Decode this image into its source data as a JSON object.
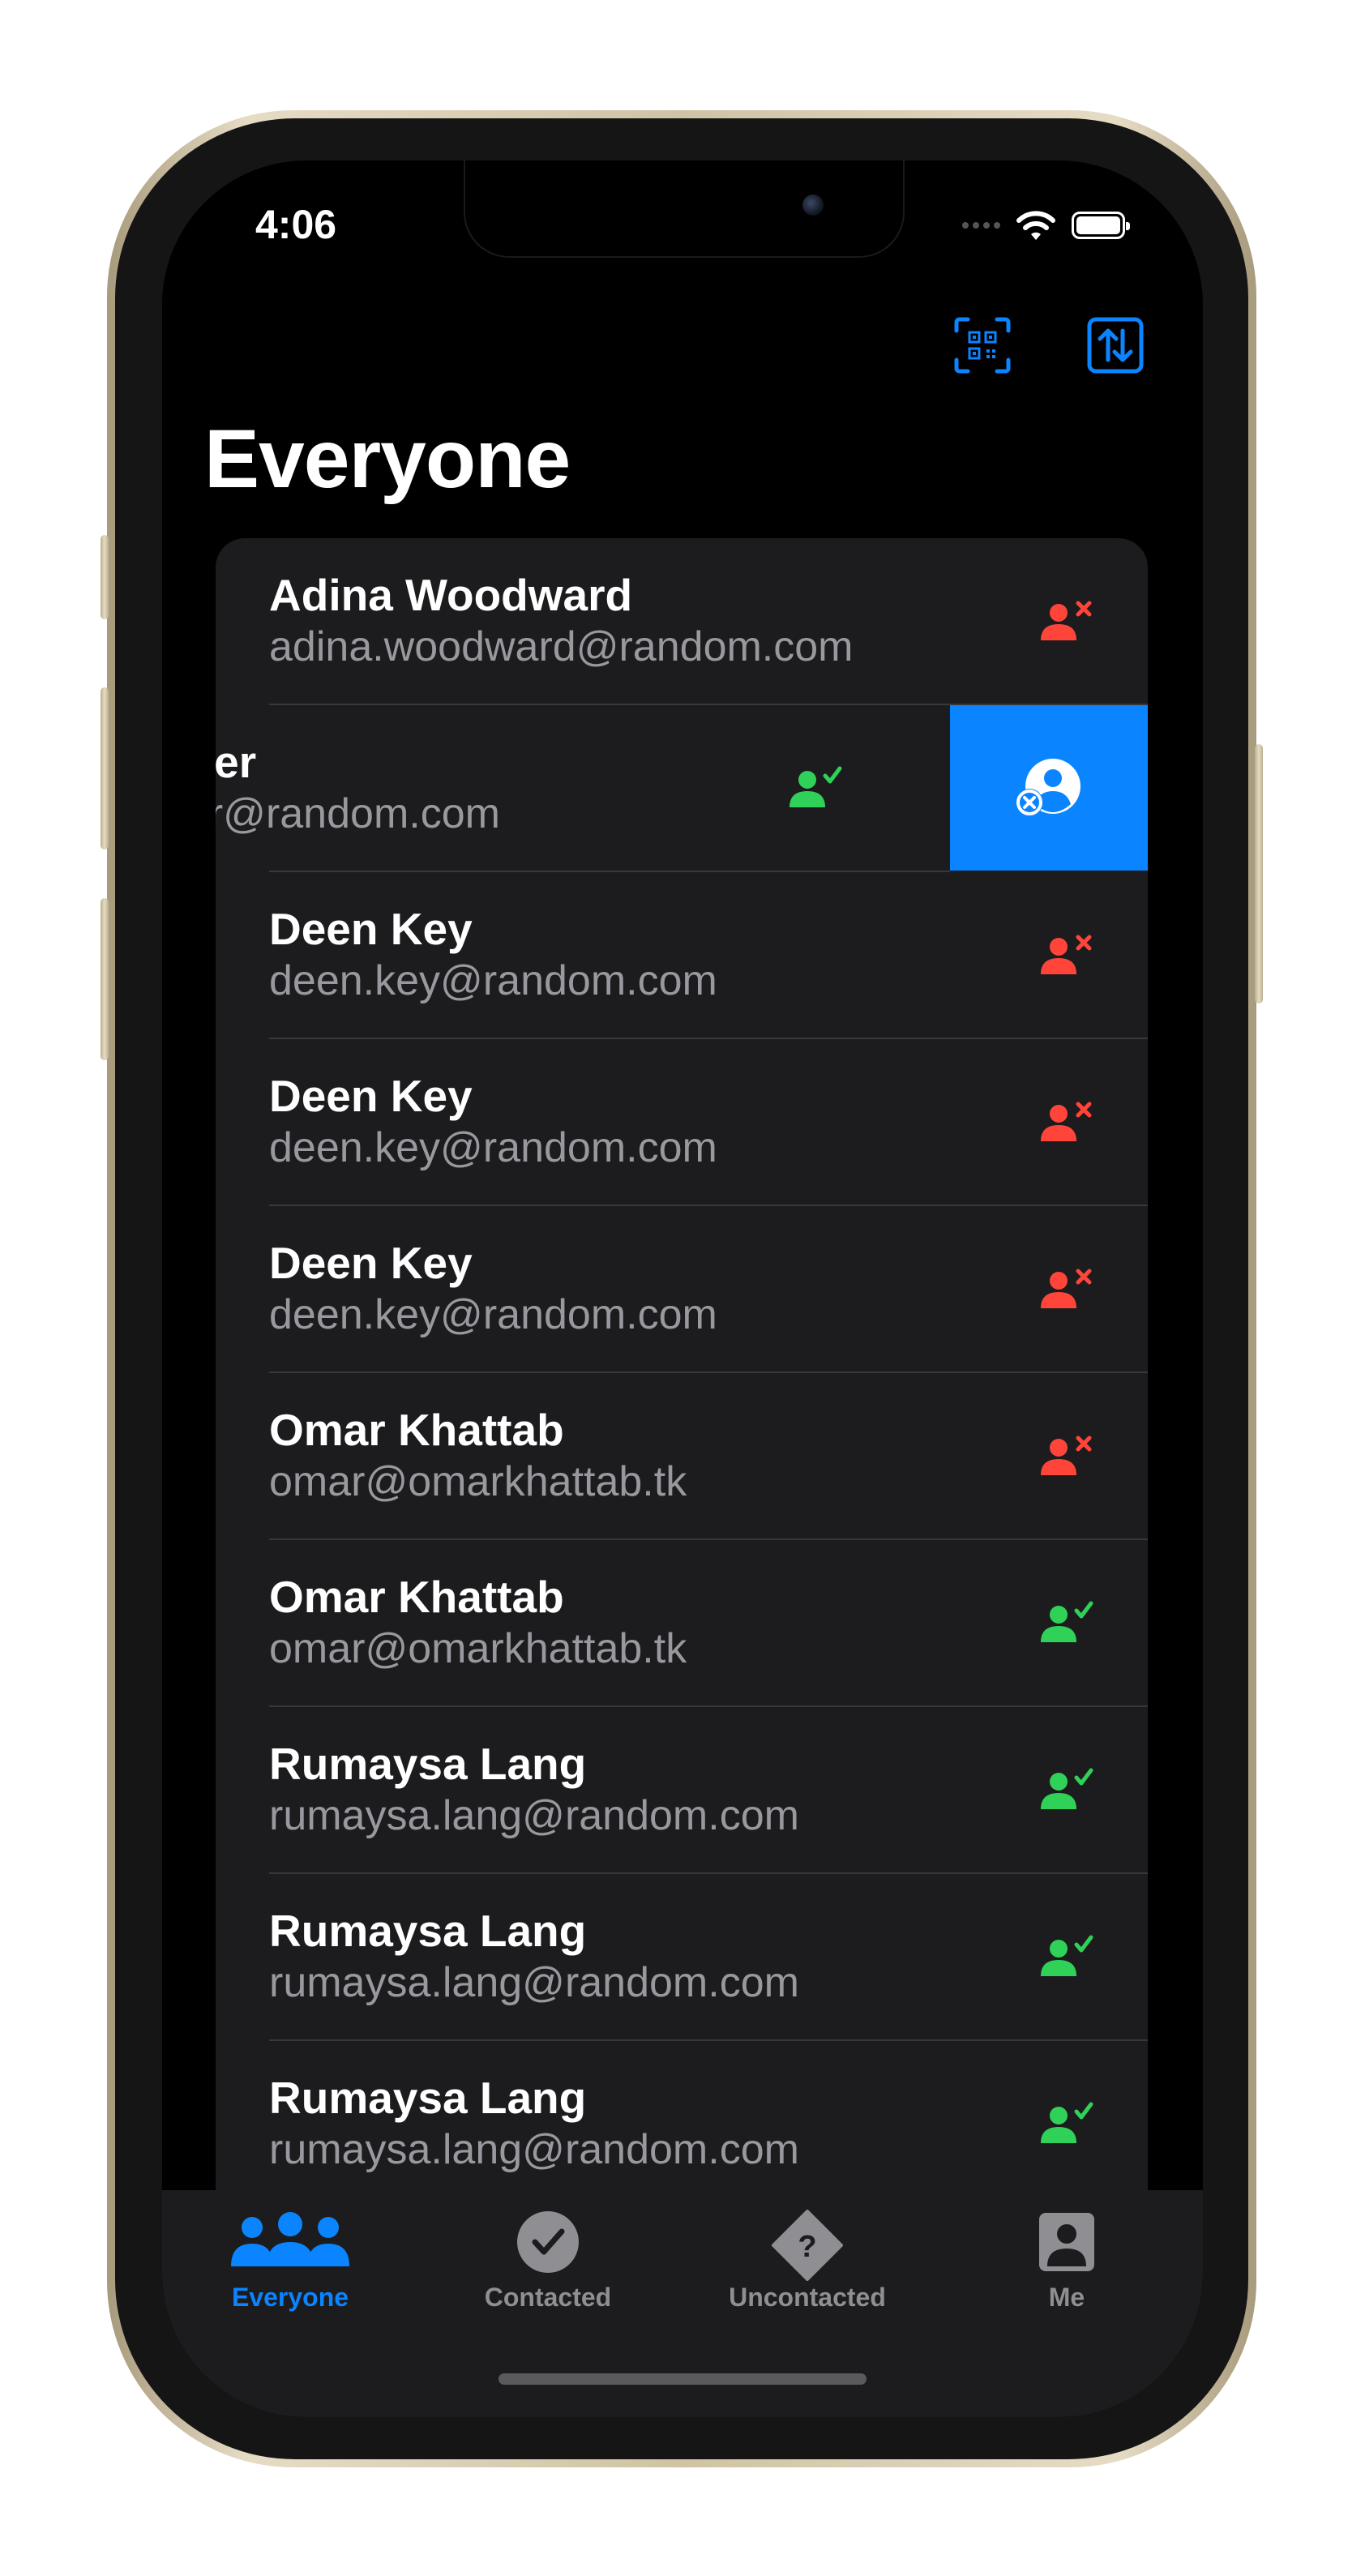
{
  "status_bar": {
    "time": "4:06"
  },
  "header": {
    "title": "Everyone"
  },
  "colors": {
    "accent": "#0a84ff",
    "contacted": "#30d158",
    "uncontacted": "#ff453a"
  },
  "contacts": [
    {
      "name": "Adina Woodward",
      "email": "adina.woodward@random.com",
      "status": "uncontacted"
    },
    {
      "name": "cher",
      "email": "her@random.com",
      "status": "contacted",
      "swiped": true
    },
    {
      "name": "Deen Key",
      "email": "deen.key@random.com",
      "status": "uncontacted"
    },
    {
      "name": "Deen Key",
      "email": "deen.key@random.com",
      "status": "uncontacted"
    },
    {
      "name": "Deen Key",
      "email": "deen.key@random.com",
      "status": "uncontacted"
    },
    {
      "name": "Omar Khattab",
      "email": "omar@omarkhattab.tk",
      "status": "uncontacted"
    },
    {
      "name": "Omar Khattab",
      "email": "omar@omarkhattab.tk",
      "status": "contacted"
    },
    {
      "name": "Rumaysa Lang",
      "email": "rumaysa.lang@random.com",
      "status": "contacted"
    },
    {
      "name": "Rumaysa Lang",
      "email": "rumaysa.lang@random.com",
      "status": "contacted"
    },
    {
      "name": "Rumaysa Lang",
      "email": "rumaysa.lang@random.com",
      "status": "contacted"
    }
  ],
  "tabs": [
    {
      "label": "Everyone",
      "icon": "people-icon",
      "active": true
    },
    {
      "label": "Contacted",
      "icon": "checkmark-circle-icon",
      "active": false
    },
    {
      "label": "Uncontacted",
      "icon": "question-diamond-icon",
      "active": false
    },
    {
      "label": "Me",
      "icon": "person-square-icon",
      "active": false
    }
  ]
}
